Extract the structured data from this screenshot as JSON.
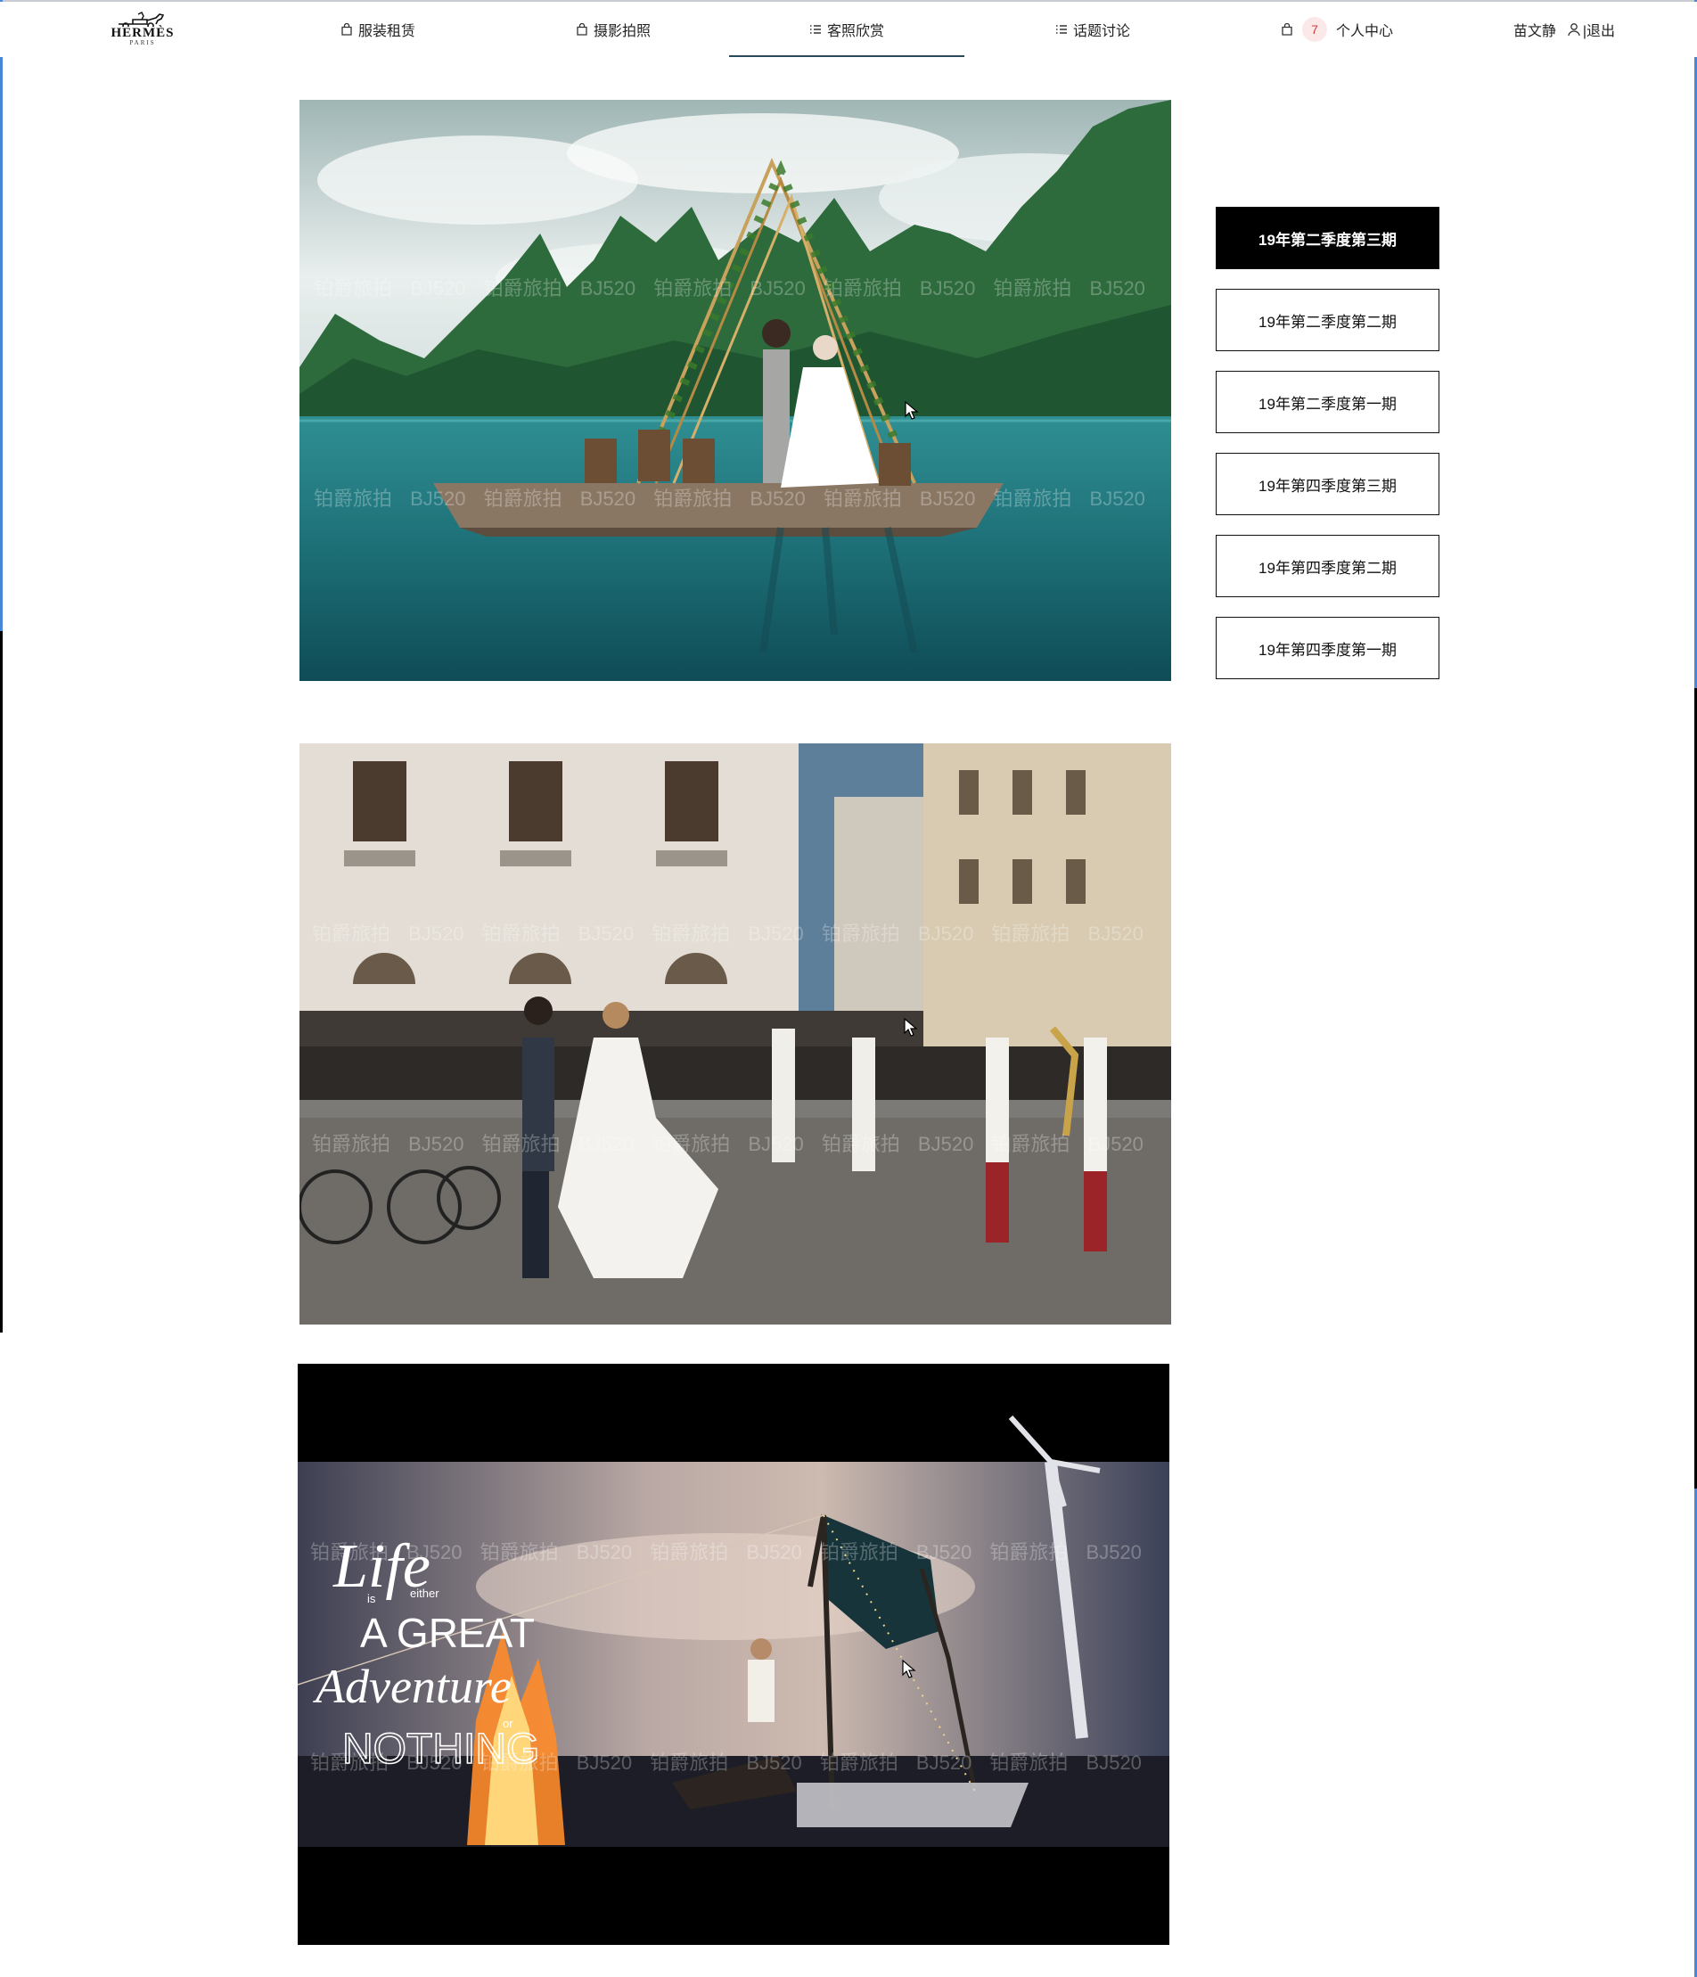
{
  "brand": {
    "logo_main": "HERMÈS",
    "logo_sub": "PARIS"
  },
  "nav": {
    "items": [
      {
        "label": "服装租赁",
        "icon": "bag-icon"
      },
      {
        "label": "摄影拍照",
        "icon": "bag-icon"
      },
      {
        "label": "客照欣赏",
        "icon": "list-icon",
        "active": true
      },
      {
        "label": "话题讨论",
        "icon": "list-icon"
      },
      {
        "label": "个人中心",
        "icon": "bag-icon",
        "badge": "7"
      }
    ]
  },
  "user": {
    "name": "苗文静",
    "logout_label": "|退出"
  },
  "issues": [
    {
      "label": "19年第二季度第三期",
      "active": true
    },
    {
      "label": "19年第二季度第二期"
    },
    {
      "label": "19年第二季度第一期"
    },
    {
      "label": "19年第四季度第三期"
    },
    {
      "label": "19年第四季度第二期"
    },
    {
      "label": "19年第四季度第一期"
    }
  ],
  "photos": {
    "watermark": "铂爵旅拍 BJ520 铂爵旅拍 BJ520 铂爵旅拍 BJ520 铂爵旅拍 BJ520 铂爵旅拍 BJ520",
    "poster_text": {
      "life": "Life",
      "is": "is",
      "either": "either",
      "a_great": "A GREAT",
      "adventure": "Adventure",
      "or": "or",
      "nothing": "NOTHING"
    }
  },
  "colors": {
    "accent": "#2a4a5c",
    "badge_bg": "#fbe9e9",
    "badge_text": "#d23c3c",
    "active_issue_bg": "#000000"
  }
}
